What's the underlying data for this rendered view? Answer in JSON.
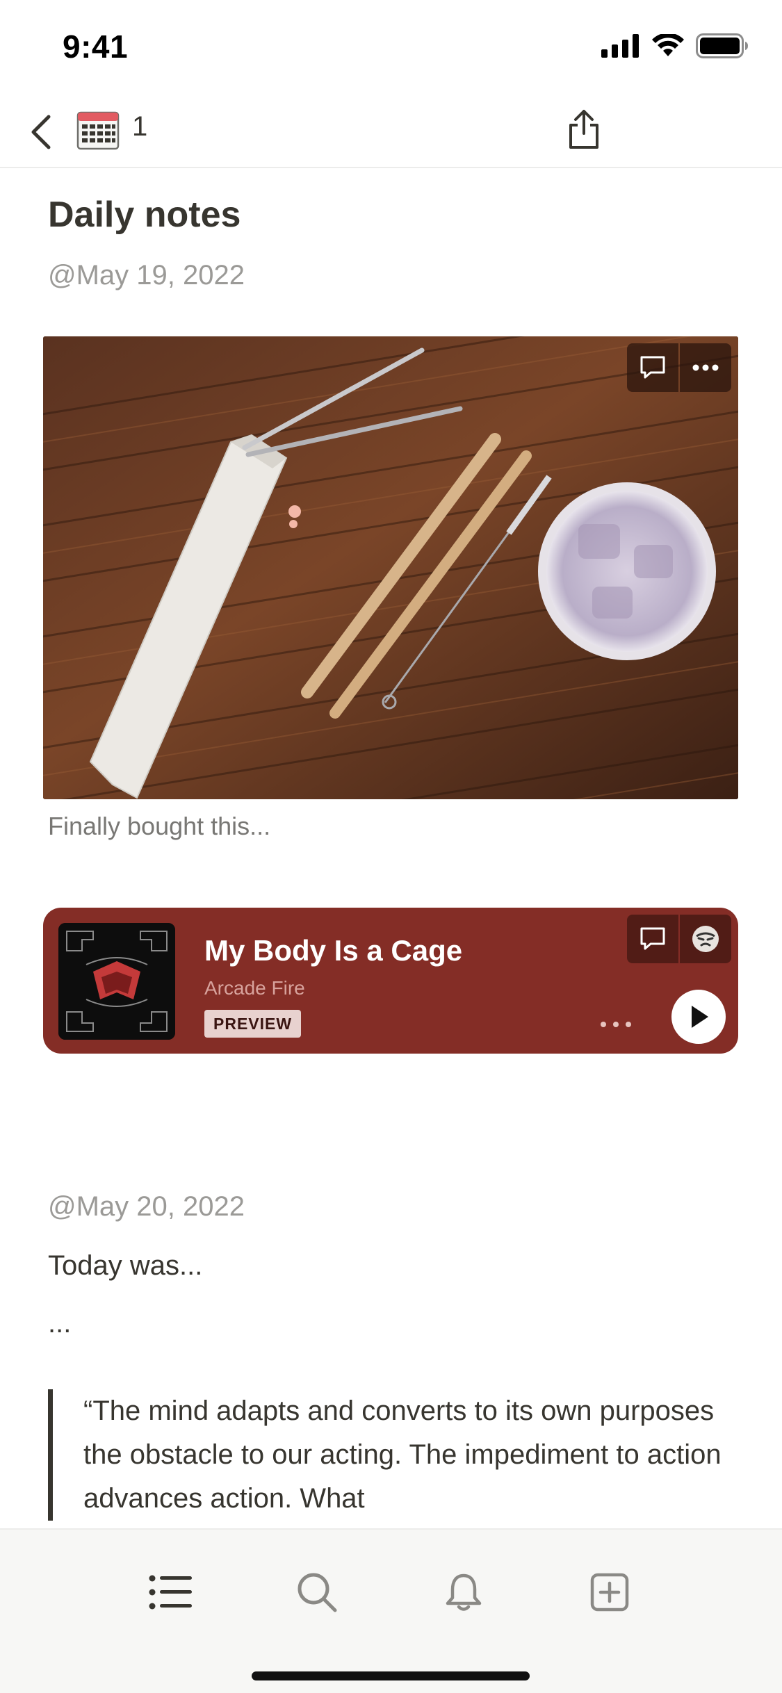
{
  "status_bar": {
    "time": "9:41"
  },
  "nav": {
    "page_count": "1"
  },
  "page": {
    "title": "Daily notes",
    "entries": [
      {
        "date": "@May 19, 2022",
        "image_caption": "Finally bought this..."
      },
      {
        "date": "@May 20, 2022"
      }
    ]
  },
  "spotify": {
    "track": "My Body Is a Cage",
    "artist": "Arcade Fire",
    "badge": "PREVIEW"
  },
  "paragraphs": [
    "Today was...",
    "..."
  ],
  "quote": "“The mind adapts and converts to its own purposes the obstacle to our acting. The impediment to action advances action. What",
  "tab_bar": {
    "items": [
      {
        "name": "list",
        "icon": "list-icon"
      },
      {
        "name": "search",
        "icon": "search-icon"
      },
      {
        "name": "notifications",
        "icon": "bell-icon"
      },
      {
        "name": "new-page",
        "icon": "plus-square-icon"
      }
    ]
  },
  "colors": {
    "spotify_card": "#842d26",
    "text": "#37352f",
    "muted": "#9b9a97",
    "tab_bar": "#f7f7f5"
  }
}
